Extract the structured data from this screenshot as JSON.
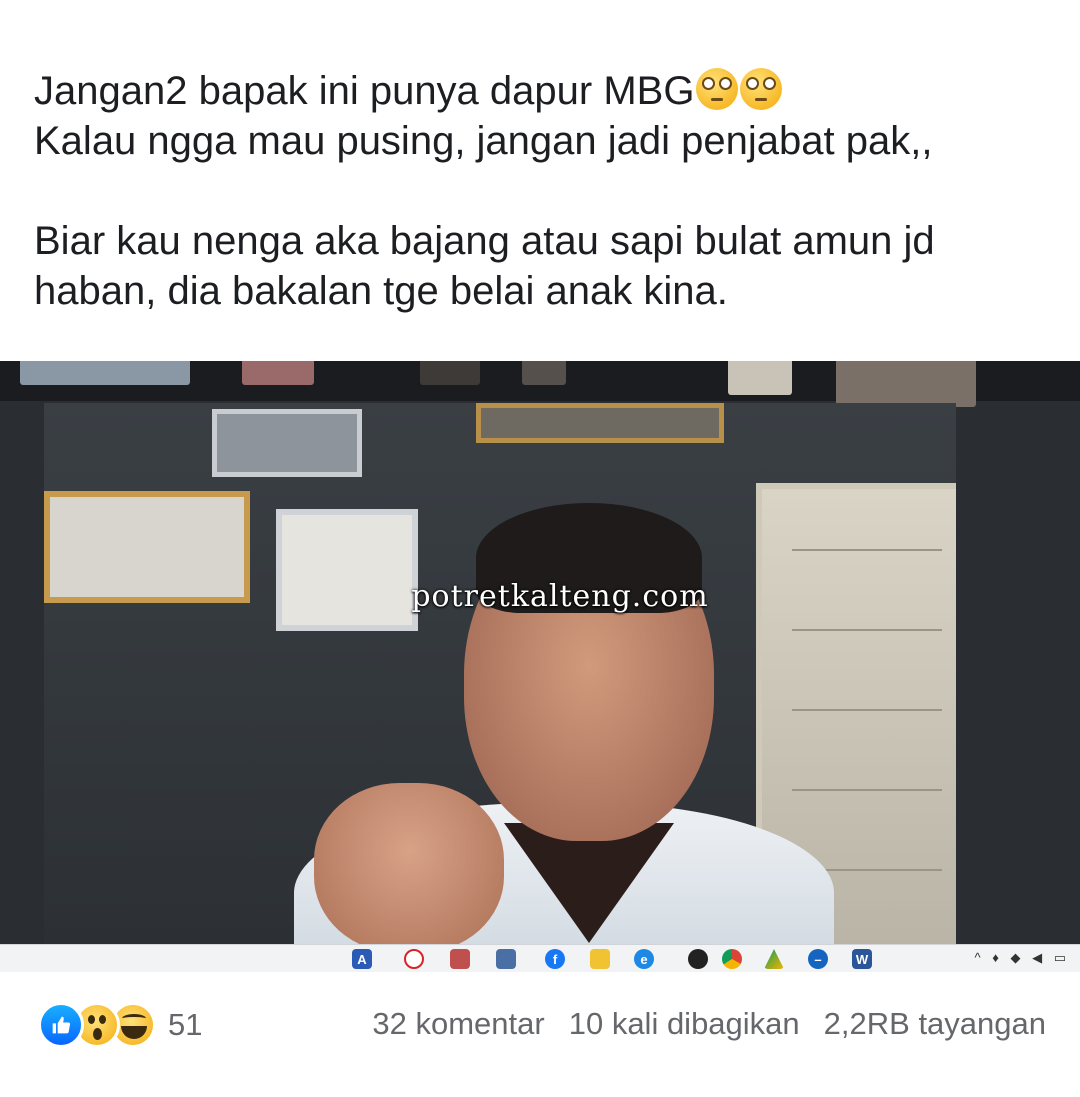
{
  "post": {
    "line1": "Jangan2 bapak ini punya dapur MBG",
    "line1_emoji": [
      "face-with-rolling-eyes",
      "face-with-rolling-eyes"
    ],
    "line2": "Kalau ngga mau pusing, jangan jadi penjabat pak,,",
    "line3": "Biar kau nenga aka bajang atau sapi bulat amun jd",
    "line4": "haban, dia bakalan tge belai anak kina."
  },
  "video": {
    "watermark": "potretkalteng.com",
    "taskbar_icons": [
      "adobe-reader-icon",
      "opera-icon",
      "app-icon",
      "app-icon",
      "facebook-icon",
      "file-explorer-icon",
      "edge-icon",
      "github-icon",
      "chrome-icon",
      "google-drive-icon",
      "app-icon",
      "word-icon"
    ]
  },
  "reactions": {
    "types": [
      "like",
      "wow",
      "haha"
    ],
    "colors": {
      "like": "#0866ff",
      "emoji": "#f7b928"
    },
    "count": "51"
  },
  "stats": {
    "comments": "32 komentar",
    "shares": "10 kali dibagikan",
    "views": "2,2RB tayangan"
  }
}
